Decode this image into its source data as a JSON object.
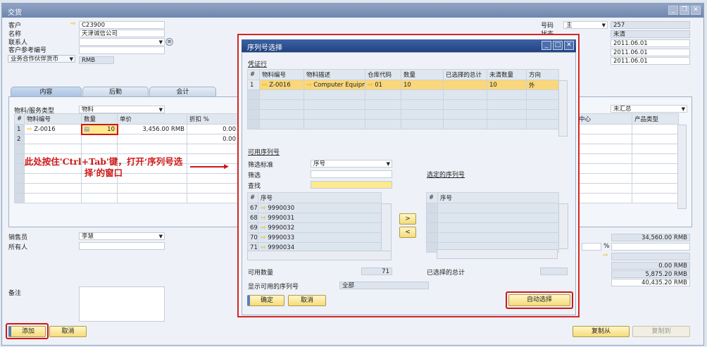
{
  "window": {
    "title": "交货",
    "controls": [
      "_",
      "❐",
      "✕"
    ]
  },
  "header": {
    "customer_label": "客户",
    "customer": "C23900",
    "name_label": "名称",
    "name": "天津诚信公司",
    "contact_label": "联系人",
    "contact": "",
    "ref_label": "客户参考编号",
    "ref": "",
    "currency_label": "业务合作伙伴货币",
    "currency": "RMB",
    "number_label": "号码",
    "series": "主",
    "number": "257",
    "status_label": "状态",
    "status": "未清",
    "dates": [
      "2011.06.01",
      "2011.06.01",
      "2011.06.01"
    ]
  },
  "tabs": [
    "内容",
    "后勤",
    "会计"
  ],
  "contents": {
    "item_type_label": "物料/服务类型",
    "item_type": "物料",
    "summary": "未汇总",
    "columns": [
      "#",
      "物料编号",
      "数量",
      "单价",
      "折扣 %"
    ],
    "right_columns": [
      "中心",
      "产品类型"
    ],
    "rows": [
      {
        "no": "1",
        "item": "Z-0016",
        "qty": "10",
        "price": "3,456.00 RMB",
        "disc": "0.00"
      },
      {
        "no": "2",
        "item": "",
        "qty": "",
        "price": "",
        "disc": "0.00"
      }
    ]
  },
  "annotation": "此处按住'Ctrl+Tab'键，打开‘序列号选择’的窗口",
  "footer": {
    "sales_label": "销售员",
    "sales": "李慧",
    "owner_label": "所有人",
    "owner": "",
    "remarks_label": "备注",
    "totals": [
      "34,560.00 RMB",
      "0.00 RMB",
      "5,875.20 RMB",
      "40,435.20 RMB"
    ],
    "percent_sign": "%",
    "add": "添加",
    "cancel": "取消",
    "copy_from": "复制从",
    "copy_to": "复制到"
  },
  "dialog": {
    "title": "序列号选择",
    "doc_lines_label": "凭证行",
    "columns": [
      "#",
      "物料编号",
      "物料描述",
      "仓库代码",
      "数量",
      "已选择的总计",
      "未清数量",
      "方向"
    ],
    "row": {
      "no": "1",
      "item": "Z-0016",
      "desc": "Computer Equipmer",
      "wh": "01",
      "qty": "10",
      "selected": "",
      "open": "10",
      "dir": "外"
    },
    "available_label": "可用序列号",
    "filter_criteria_label": "筛选标准",
    "filter_criteria": "序号",
    "filter_label": "筛选",
    "filter": "",
    "find_label": "查找",
    "find": "",
    "list_columns": [
      "#",
      "序号"
    ],
    "serials": [
      {
        "no": "67",
        "sn": "9990030"
      },
      {
        "no": "68",
        "sn": "9990031"
      },
      {
        "no": "69",
        "sn": "9990032"
      },
      {
        "no": "70",
        "sn": "9990033"
      },
      {
        "no": "71",
        "sn": "9990034"
      }
    ],
    "selected_label": "选定的序列号",
    "add_arrow": ">",
    "remove_arrow": "<",
    "avail_qty_label": "可用数量",
    "avail_qty": "71",
    "sel_total_label": "已选择的总计",
    "sel_total": "",
    "show_label": "显示可用的序列号",
    "show": "全部",
    "ok": "确定",
    "cancel": "取消",
    "auto": "自动选择"
  }
}
